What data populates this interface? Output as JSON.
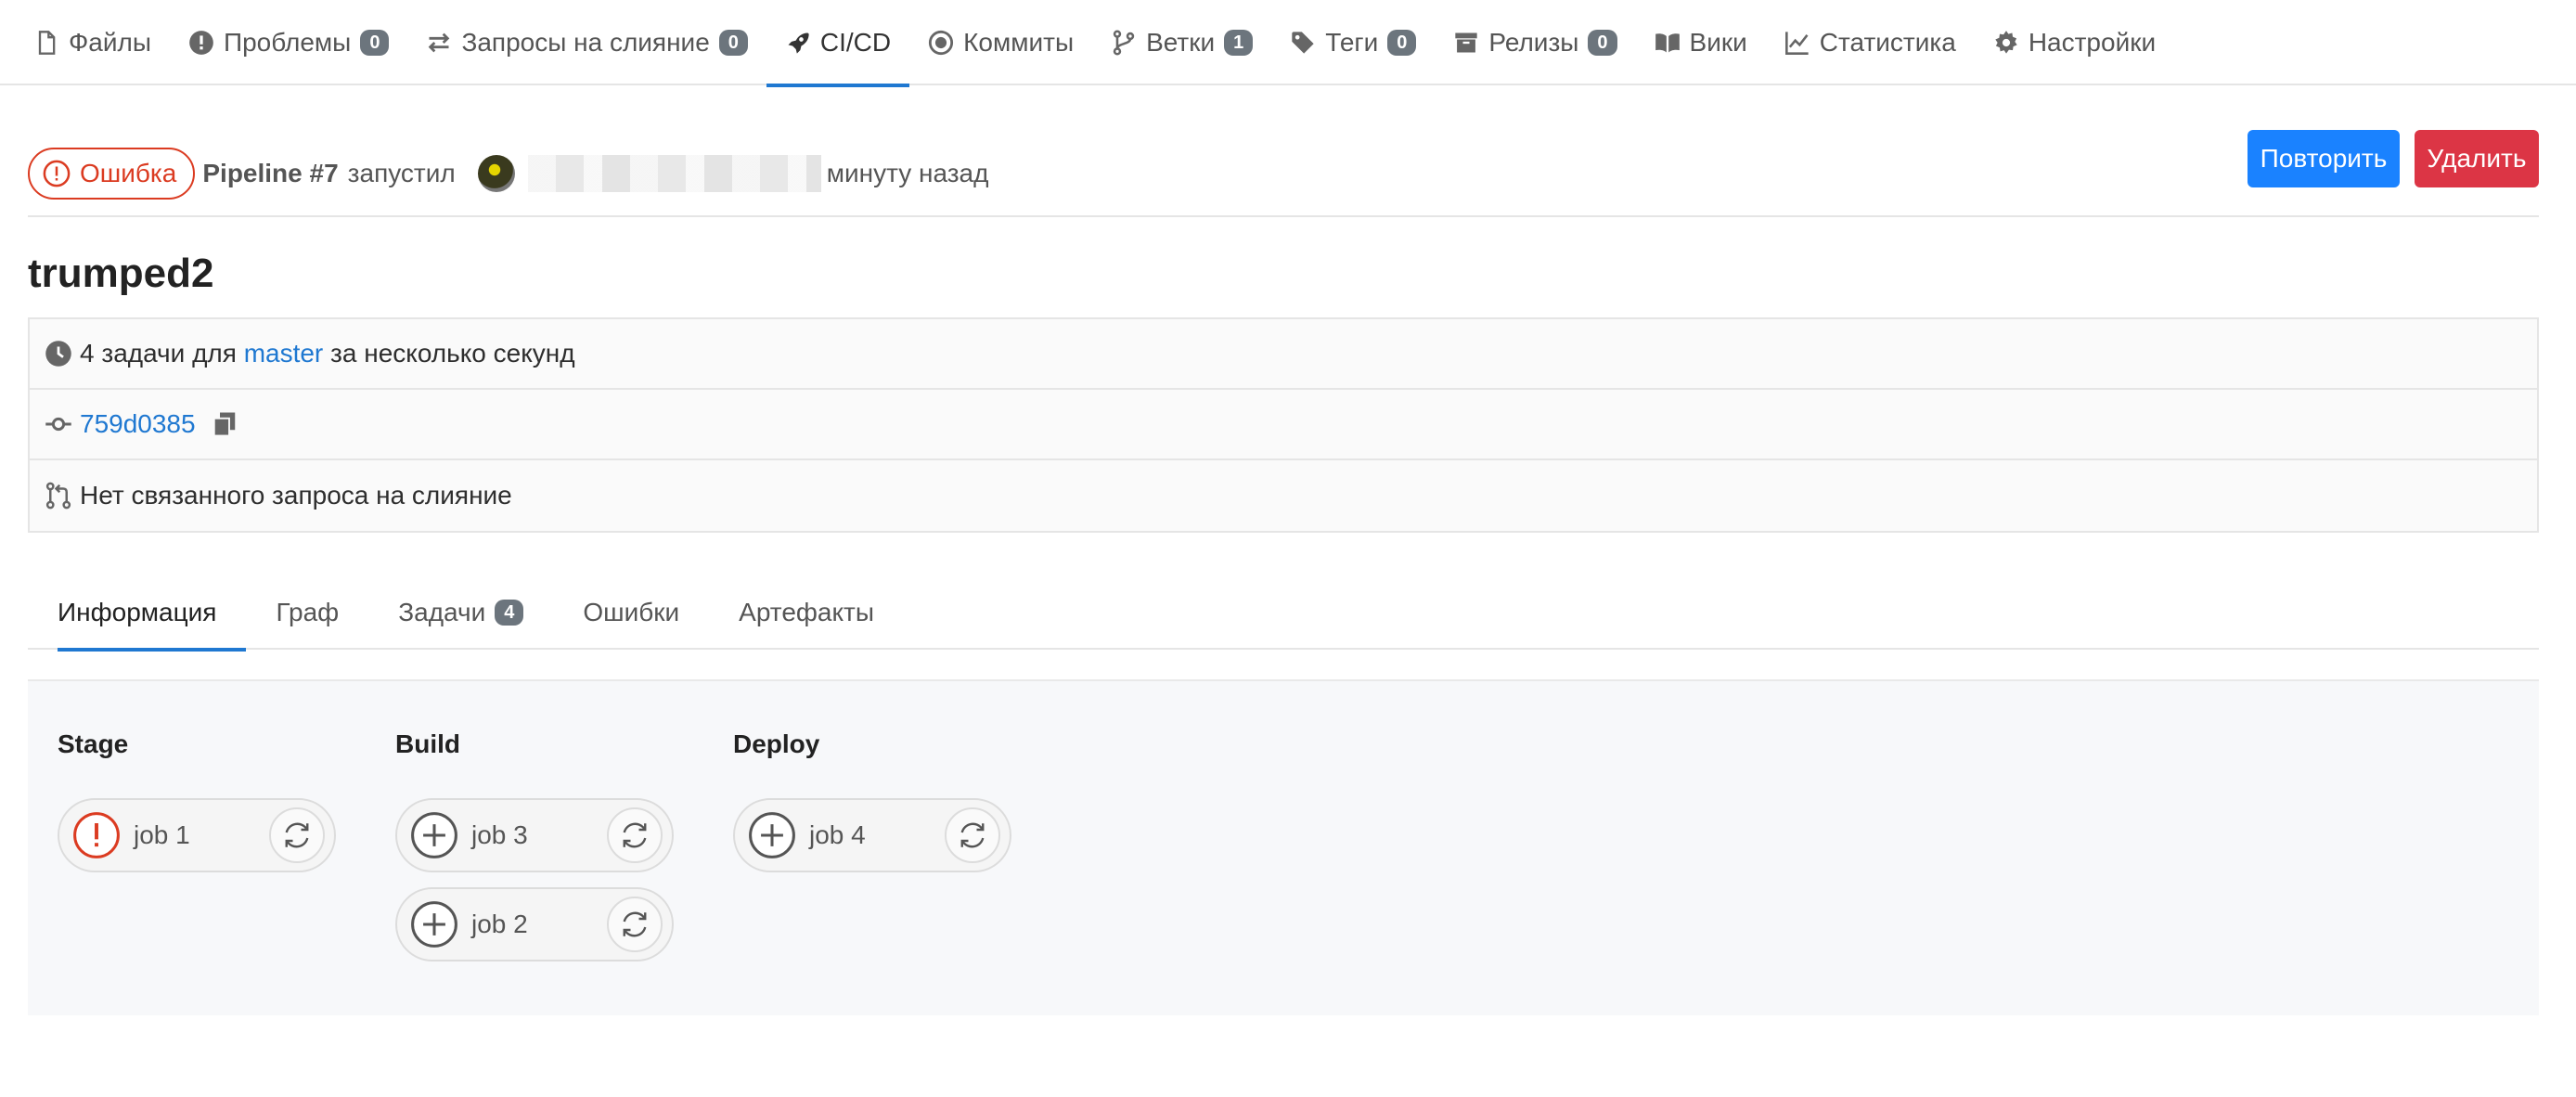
{
  "nav": {
    "items": [
      {
        "label": "Файлы",
        "icon": "file-icon"
      },
      {
        "label": "Проблемы",
        "icon": "issue-icon",
        "count": "0"
      },
      {
        "label": "Запросы на слияние",
        "icon": "merge-arrows-icon",
        "count": "0"
      },
      {
        "label": "CI/CD",
        "icon": "rocket-icon",
        "active": true
      },
      {
        "label": "Коммиты",
        "icon": "commit-dot-icon"
      },
      {
        "label": "Ветки",
        "icon": "branch-icon",
        "count": "1"
      },
      {
        "label": "Теги",
        "icon": "tag-icon",
        "count": "0"
      },
      {
        "label": "Релизы",
        "icon": "archive-icon",
        "count": "0"
      },
      {
        "label": "Вики",
        "icon": "book-icon"
      },
      {
        "label": "Статистика",
        "icon": "chart-line-icon"
      },
      {
        "label": "Настройки",
        "icon": "gear-icon"
      }
    ]
  },
  "pipeline": {
    "status": "Ошибка",
    "status_color": "#db3b21",
    "title": "Pipeline #7",
    "triggered_by": "запустил",
    "time_ago": "минуту назад"
  },
  "actions": {
    "retry_label": "Повторить",
    "delete_label": "Удалить",
    "retry_color": "#1a82ff",
    "delete_color": "#dc3545"
  },
  "commit": {
    "title": "trumped2",
    "jobs_prefix": "4 задачи для",
    "branch": "master",
    "duration": "за несколько секунд",
    "sha": "759d0385",
    "merge_request": "Нет связанного запроса на слияние"
  },
  "tabs": [
    {
      "label": "Информация",
      "active": true
    },
    {
      "label": "Граф"
    },
    {
      "label": "Задачи",
      "count": "4"
    },
    {
      "label": "Ошибки"
    },
    {
      "label": "Артефакты"
    }
  ],
  "stages": [
    {
      "name": "Stage",
      "jobs": [
        {
          "name": "job 1",
          "status": "failed"
        }
      ]
    },
    {
      "name": "Build",
      "jobs": [
        {
          "name": "job 3",
          "status": "created"
        },
        {
          "name": "job 2",
          "status": "created"
        }
      ]
    },
    {
      "name": "Deploy",
      "jobs": [
        {
          "name": "job 4",
          "status": "created"
        }
      ]
    }
  ],
  "colors": {
    "accent": "#1f78d1",
    "failed": "#db3b21",
    "link": "#1f78d1"
  }
}
